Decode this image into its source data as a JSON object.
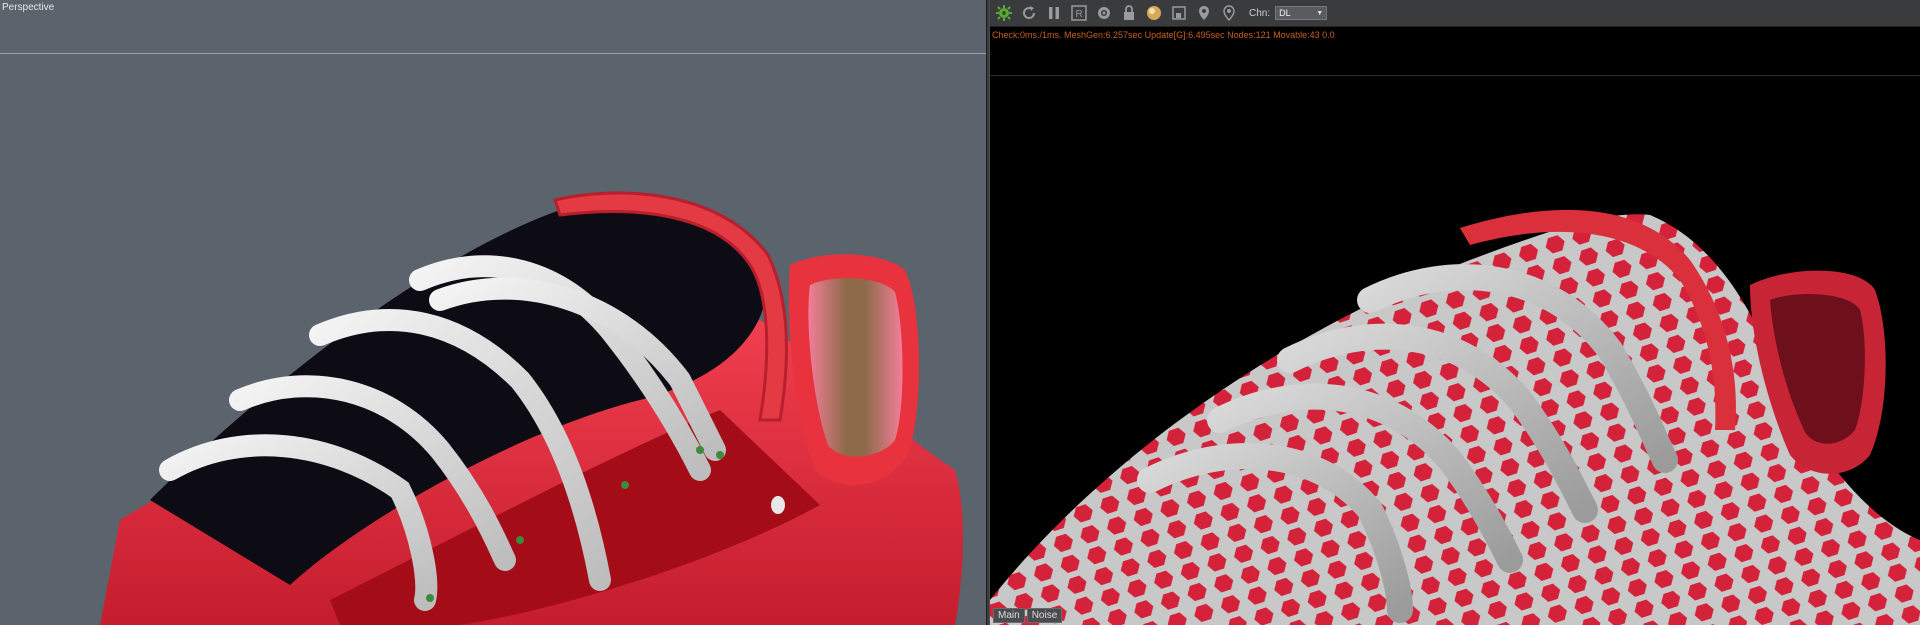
{
  "left_viewport": {
    "label": "Perspective"
  },
  "right_viewport": {
    "toolbar": {
      "icons": [
        "render-start-icon",
        "refresh-icon",
        "pause-icon",
        "region-icon",
        "settings-icon",
        "lock-icon",
        "material-sphere-icon",
        "window-icon",
        "pin-icon",
        "pin-alt-icon"
      ],
      "region_label": "R",
      "chn_label": "Chn:",
      "chn_value": "DL"
    },
    "status": "Check:0ms./1ms. MeshGen:6.257sec Update[G]:6.495sec Nodes:121 Movable:43  0.0",
    "bottom_tabs": [
      "Main",
      "Noise"
    ]
  },
  "colors": {
    "viewport_bg": "#5b636c",
    "render_bg": "#000000",
    "status_text": "#c6611e",
    "shoe_red": "#e0293a",
    "lace_white": "#e8e8e8"
  }
}
